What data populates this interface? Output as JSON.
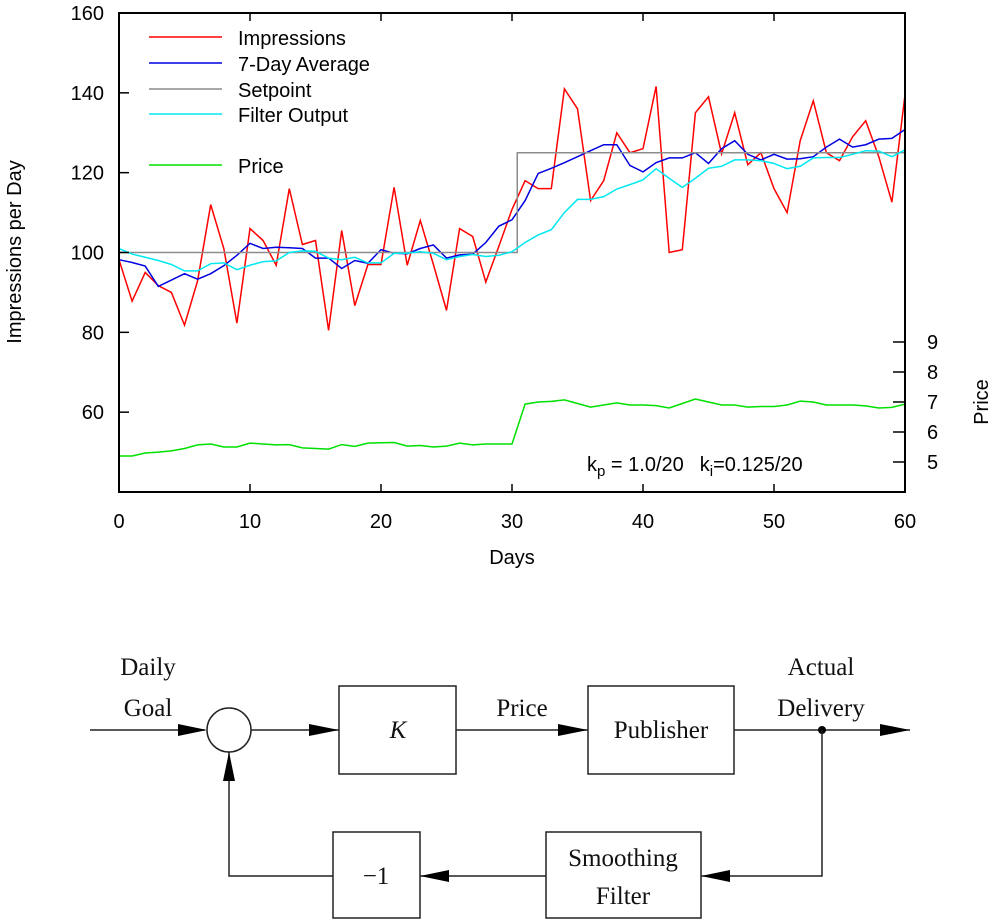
{
  "chart_data": {
    "type": "line",
    "title": "",
    "xlabel": "Days",
    "ylabel": "Impressions per Day",
    "y2label": "Price",
    "xlim": [
      0,
      60
    ],
    "ylim": [
      40,
      160
    ],
    "y2lim": [
      4,
      20
    ],
    "grid": false,
    "legend_position": "top-left",
    "x_ticks": [
      0,
      10,
      20,
      30,
      40,
      50,
      60
    ],
    "x_tick_labels": [
      "0",
      "10",
      "20",
      "30",
      "40",
      "50",
      "60"
    ],
    "y_ticks": [
      60,
      80,
      100,
      120,
      140,
      160
    ],
    "y_tick_labels": [
      "60",
      "80",
      "100",
      "120",
      "140",
      "160"
    ],
    "y2_ticks": [
      5,
      6,
      7,
      8,
      9
    ],
    "y2_tick_labels": [
      "5",
      "6",
      "7",
      "8",
      "9"
    ],
    "annotation": {
      "kp_sym": "k",
      "kp_sub": "p",
      "kp_val": " = 1.0/20",
      "ki_sym": "k",
      "ki_sub": "i",
      "ki_val": "=0.125/20"
    },
    "x": [
      0,
      1,
      2,
      3,
      4,
      5,
      6,
      7,
      8,
      9,
      10,
      11,
      12,
      13,
      14,
      15,
      16,
      17,
      18,
      19,
      20,
      21,
      22,
      23,
      24,
      25,
      26,
      27,
      28,
      29,
      30,
      31,
      32,
      33,
      34,
      35,
      36,
      37,
      38,
      39,
      40,
      41,
      42,
      43,
      44,
      45,
      46,
      47,
      48,
      49,
      50,
      51,
      52,
      53,
      54,
      55,
      56,
      57,
      58,
      59,
      60
    ],
    "series": [
      {
        "name": "Impressions",
        "color": "#ff0000",
        "axis": "left",
        "values": [
          98.2,
          87.8,
          95,
          91.7,
          90,
          81.8,
          92.9,
          112,
          101,
          82.3,
          106,
          103,
          96.8,
          116,
          102,
          103,
          80.5,
          105.5,
          86.7,
          97,
          97,
          116.3,
          96.8,
          108,
          97,
          85.5,
          106,
          104,
          92.6,
          101.6,
          110.8,
          118,
          116,
          116,
          141,
          136,
          113,
          118,
          130,
          125,
          126,
          141.6,
          100,
          100.7,
          135,
          139,
          124.7,
          135,
          122,
          125,
          116,
          110,
          128,
          138,
          125,
          123,
          129,
          133,
          124,
          112.6,
          139.5
        ]
      },
      {
        "name": "7-Day Average",
        "color": "#0000e0",
        "axis": "left",
        "values": [
          98.2,
          97.5,
          96.6,
          91.5,
          93.1,
          94.7,
          93.3,
          94.7,
          96.7,
          99.3,
          102.3,
          101,
          101.3,
          101.2,
          101,
          98.6,
          98.6,
          96,
          98,
          97.3,
          100.7,
          99.8,
          99.7,
          101,
          101.9,
          98.6,
          99.4,
          99.6,
          102.5,
          106.6,
          108.2,
          113,
          119.8,
          121.1,
          122.5,
          124,
          125.5,
          127,
          127,
          121.8,
          120.2,
          122.5,
          123.7,
          123.7,
          125,
          122.3,
          126,
          128,
          124.6,
          123.2,
          124.6,
          123.4,
          123.5,
          124,
          126.4,
          128.4,
          126.4,
          127,
          128.4,
          128.6,
          130.8
        ]
      },
      {
        "name": "Setpoint",
        "color": "#8c8c8c",
        "axis": "left",
        "step_at": 30.4,
        "values": [
          100,
          100,
          100,
          100,
          100,
          100,
          100,
          100,
          100,
          100,
          100,
          100,
          100,
          100,
          100,
          100,
          100,
          100,
          100,
          100,
          100,
          100,
          100,
          100,
          100,
          100,
          100,
          100,
          100,
          100,
          100,
          125,
          125,
          125,
          125,
          125,
          125,
          125,
          125,
          125,
          125,
          125,
          125,
          125,
          125,
          125,
          125,
          125,
          125,
          125,
          125,
          125,
          125,
          125,
          125,
          125,
          125,
          125,
          125,
          125,
          125
        ]
      },
      {
        "name": "Filter Output",
        "color": "#00e8f0",
        "axis": "left",
        "values": [
          101,
          99.6,
          98.8,
          98,
          97,
          95.4,
          95.4,
          97.2,
          97.4,
          95.7,
          96.8,
          97.7,
          97.9,
          100,
          100.4,
          100.3,
          98.6,
          98.2,
          98.8,
          97.4,
          97.4,
          99.8,
          99.8,
          100.2,
          99.8,
          98.2,
          99,
          99.5,
          99,
          99.3,
          100.2,
          102.5,
          104.4,
          105.7,
          110,
          113.3,
          113.3,
          114,
          115.9,
          117,
          118.2,
          121,
          118.6,
          116.3,
          118.6,
          121.1,
          121.6,
          123.2,
          123.2,
          123,
          122.3,
          121,
          121.6,
          123.7,
          123.8,
          123.8,
          124.6,
          125.5,
          125.4,
          124,
          125.7
        ]
      },
      {
        "name": "Price",
        "color": "#00e000",
        "axis": "right",
        "values": [
          5.2,
          5.2,
          5.3,
          5.33,
          5.37,
          5.45,
          5.57,
          5.6,
          5.5,
          5.5,
          5.63,
          5.6,
          5.57,
          5.58,
          5.47,
          5.45,
          5.43,
          5.58,
          5.52,
          5.63,
          5.64,
          5.65,
          5.53,
          5.55,
          5.5,
          5.53,
          5.63,
          5.57,
          5.6,
          5.6,
          5.6,
          6.93,
          7.0,
          7.02,
          7.07,
          6.95,
          6.83,
          6.9,
          6.97,
          6.9,
          6.9,
          6.88,
          6.8,
          6.95,
          7.1,
          7.0,
          6.9,
          6.9,
          6.83,
          6.85,
          6.85,
          6.9,
          7.03,
          7.0,
          6.9,
          6.9,
          6.9,
          6.87,
          6.8,
          6.82,
          6.93
        ]
      }
    ]
  },
  "diagram": {
    "input_label_line1": "Daily",
    "input_label_line2": "Goal",
    "controller_label": "K",
    "signal_label": "Price",
    "plant_label": "Publisher",
    "output_label_line1": "Actual",
    "output_label_line2": "Delivery",
    "filter_label_line1": "Smoothing",
    "filter_label_line2": "Filter",
    "gain_label": "−1"
  }
}
